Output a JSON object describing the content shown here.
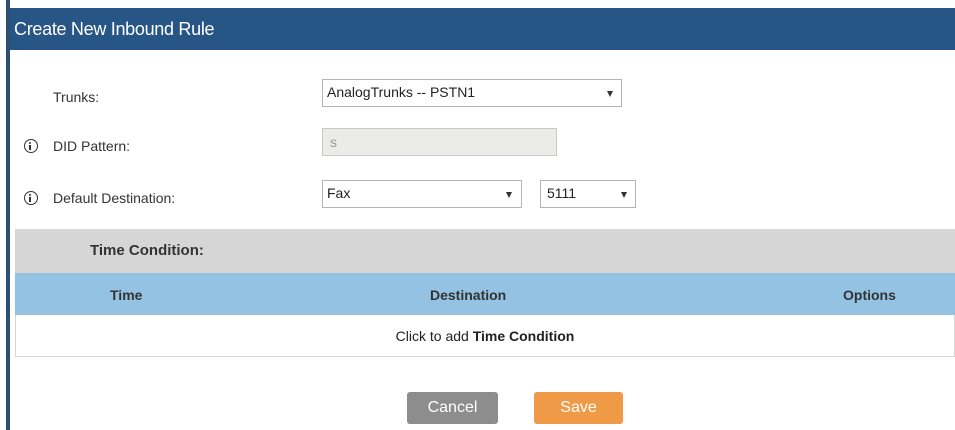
{
  "dialog": {
    "title": "Create New Inbound Rule"
  },
  "form": {
    "trunks": {
      "label": "Trunks:",
      "value": "AnalogTrunks -- PSTN1"
    },
    "did_pattern": {
      "label": "DID Pattern:",
      "value": "s"
    },
    "default_destination": {
      "label": "Default Destination:",
      "type_value": "Fax",
      "extension_value": "5111"
    }
  },
  "time_condition": {
    "label": "Time Condition:",
    "columns": [
      "Time",
      "Destination",
      "Options"
    ],
    "add_prefix": "Click to add",
    "add_target": "Time Condition"
  },
  "buttons": {
    "cancel": "Cancel",
    "save": "Save"
  },
  "colors": {
    "titlebar": "#265586",
    "table_header": "#93c2e3",
    "section_header": "#d6d6d6",
    "cancel": "#8d8d8d",
    "save": "#ef9a47"
  },
  "icons": [
    "info-icon",
    "chevron-down-icon"
  ]
}
